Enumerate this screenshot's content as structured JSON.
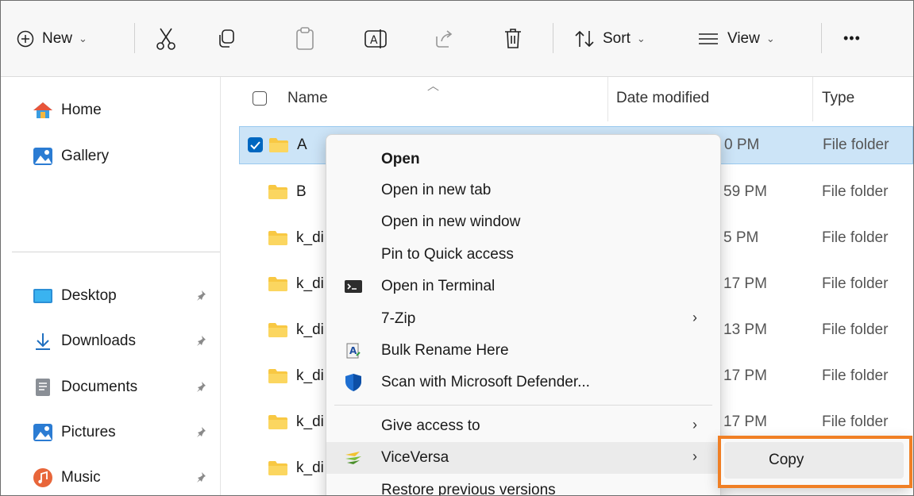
{
  "toolbar": {
    "new_label": "New",
    "sort_label": "Sort",
    "view_label": "View",
    "more_label": "•••"
  },
  "nav": {
    "items": [
      {
        "label": "Home",
        "icon": "home-icon"
      },
      {
        "label": "Gallery",
        "icon": "gallery-icon"
      },
      {
        "label": "Desktop",
        "icon": "desktop-icon"
      },
      {
        "label": "Downloads",
        "icon": "downloads-icon"
      },
      {
        "label": "Documents",
        "icon": "documents-icon"
      },
      {
        "label": "Pictures",
        "icon": "pictures-icon"
      },
      {
        "label": "Music",
        "icon": "music-icon"
      }
    ]
  },
  "columns": {
    "name": "Name",
    "date": "Date modified",
    "type": "Type"
  },
  "rows": [
    {
      "name": "A",
      "date": "0 PM",
      "type": "File folder",
      "selected": true
    },
    {
      "name": "B",
      "date": "59 PM",
      "type": "File folder"
    },
    {
      "name": "k_di",
      "date": "5 PM",
      "type": "File folder"
    },
    {
      "name": "k_di",
      "date": "17 PM",
      "type": "File folder"
    },
    {
      "name": "k_di",
      "date": "13 PM",
      "type": "File folder"
    },
    {
      "name": "k_di",
      "date": "17 PM",
      "type": "File folder"
    },
    {
      "name": "k_di",
      "date": "17 PM",
      "type": "File folder"
    },
    {
      "name": "k_di",
      "date": "",
      "type": ""
    }
  ],
  "context_menu": {
    "items": [
      {
        "label": "Open"
      },
      {
        "label": "Open in new tab"
      },
      {
        "label": "Open in new window"
      },
      {
        "label": "Pin to Quick access"
      },
      {
        "label": "Open in Terminal",
        "icon": "terminal-icon"
      },
      {
        "label": "7-Zip",
        "submenu": true
      },
      {
        "label": "Bulk Rename Here",
        "icon": "bulk-rename-icon"
      },
      {
        "label": "Scan with Microsoft Defender...",
        "icon": "defender-shield-icon"
      },
      {
        "label": "Give access to",
        "submenu": true
      },
      {
        "label": "ViceVersa",
        "icon": "viceversa-icon",
        "submenu": true,
        "hovered": true
      },
      {
        "label": "Restore previous versions"
      }
    ],
    "arrow_glyph": "›"
  },
  "submenu": {
    "items": [
      {
        "label": "Copy"
      }
    ],
    "highlight_color": "#f07f24"
  },
  "colors": {
    "selection": "#cce4f7",
    "accent": "#0067c0",
    "folder": "#f8c843"
  }
}
